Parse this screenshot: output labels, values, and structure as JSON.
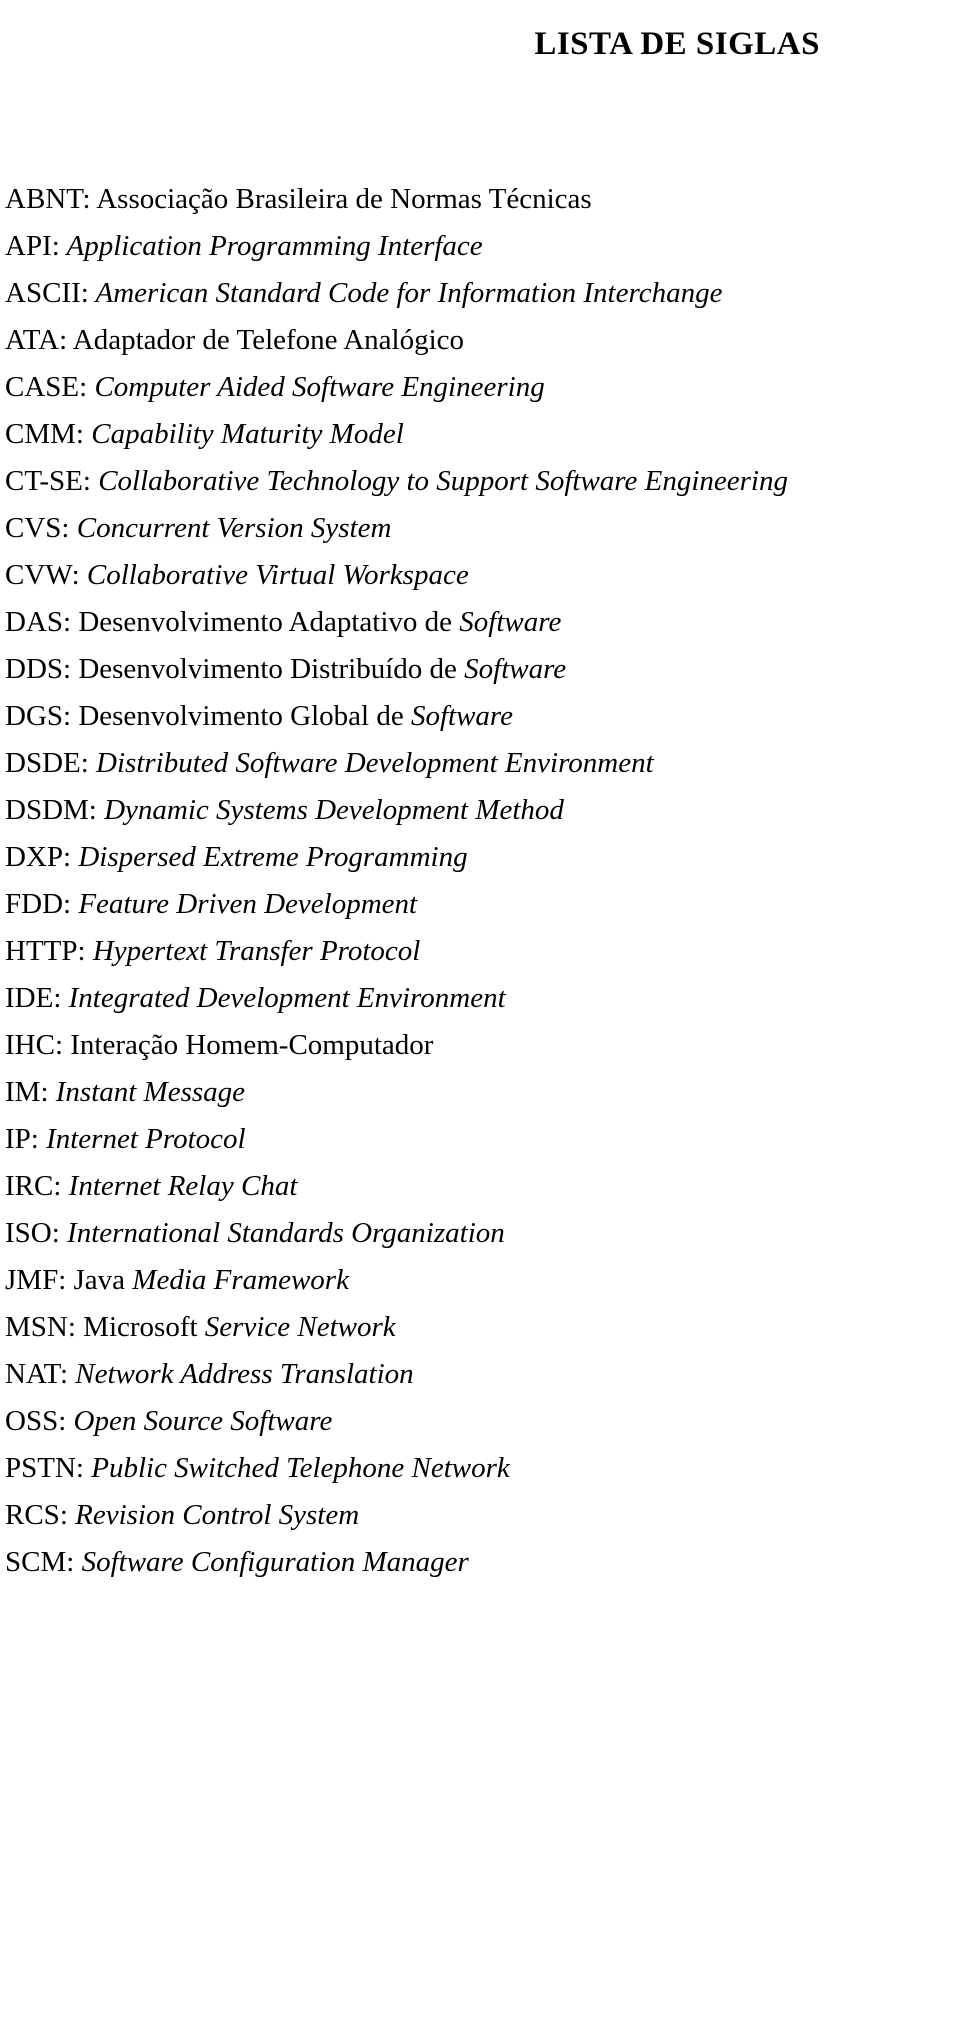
{
  "document": {
    "title": "LISTA DE SIGLAS"
  },
  "abbreviations": [
    {
      "key": "ABNT:",
      "segments": [
        {
          "text": " Associação Brasileira de Normas Técnicas",
          "style": "roman"
        }
      ]
    },
    {
      "key": "API:",
      "segments": [
        {
          "text": " Application Programming Interface",
          "style": "italic"
        }
      ]
    },
    {
      "key": "ASCII:",
      "segments": [
        {
          "text": " American Standard Code for Information Interchange",
          "style": "italic"
        }
      ]
    },
    {
      "key": "ATA:",
      "segments": [
        {
          "text": " Adaptador de Telefone Analógico",
          "style": "roman"
        }
      ]
    },
    {
      "key": "CASE:",
      "segments": [
        {
          "text": " Computer Aided Software Engineering",
          "style": "italic"
        }
      ]
    },
    {
      "key": "CMM:",
      "segments": [
        {
          "text": " Capability Maturity Model",
          "style": "italic"
        }
      ]
    },
    {
      "key": "CT-SE:",
      "segments": [
        {
          "text": " Collaborative Technology to Support Software Engineering",
          "style": "italic"
        }
      ]
    },
    {
      "key": "CVS:",
      "segments": [
        {
          "text": " Concurrent Version System",
          "style": "italic"
        }
      ]
    },
    {
      "key": "CVW:",
      "segments": [
        {
          "text": " Collaborative Virtual Workspace",
          "style": "italic"
        }
      ]
    },
    {
      "key": "DAS:",
      "segments": [
        {
          "text": " Desenvolvimento Adaptativo de ",
          "style": "roman"
        },
        {
          "text": "Software",
          "style": "italic"
        }
      ]
    },
    {
      "key": "DDS:",
      "segments": [
        {
          "text": " Desenvolvimento Distribuído de ",
          "style": "roman"
        },
        {
          "text": "Software",
          "style": "italic"
        }
      ]
    },
    {
      "key": "DGS:",
      "segments": [
        {
          "text": " Desenvolvimento Global de ",
          "style": "roman"
        },
        {
          "text": "Software",
          "style": "italic"
        }
      ]
    },
    {
      "key": "DSDE:",
      "segments": [
        {
          "text": " Distributed Software Development Environment",
          "style": "italic"
        }
      ]
    },
    {
      "key": "DSDM:",
      "segments": [
        {
          "text": " Dynamic Systems Development Method",
          "style": "italic"
        }
      ]
    },
    {
      "key": "DXP:",
      "segments": [
        {
          "text": " Dispersed Extreme Programming",
          "style": "italic"
        }
      ]
    },
    {
      "key": "FDD:",
      "segments": [
        {
          "text": " Feature Driven Development",
          "style": "italic"
        }
      ]
    },
    {
      "key": "HTTP:",
      "segments": [
        {
          "text": " Hypertext Transfer Protocol",
          "style": "italic"
        }
      ]
    },
    {
      "key": "IDE:",
      "segments": [
        {
          "text": " Integrated Development Environment",
          "style": "italic"
        }
      ]
    },
    {
      "key": "IHC:",
      "segments": [
        {
          "text": " Interação Homem-Computador",
          "style": "roman"
        }
      ]
    },
    {
      "key": "IM:",
      "segments": [
        {
          "text": " Instant Message",
          "style": "italic"
        }
      ]
    },
    {
      "key": "IP:",
      "segments": [
        {
          "text": " Internet Protocol",
          "style": "italic"
        }
      ]
    },
    {
      "key": "IRC:",
      "segments": [
        {
          "text": " Internet Relay Chat",
          "style": "italic"
        }
      ]
    },
    {
      "key": "ISO:",
      "segments": [
        {
          "text": " International Standards Organization",
          "style": "italic"
        }
      ]
    },
    {
      "key": "JMF:",
      "segments": [
        {
          "text": " Java ",
          "style": "roman"
        },
        {
          "text": "Media Framework",
          "style": "italic"
        }
      ]
    },
    {
      "key": "MSN:",
      "segments": [
        {
          "text": " Microsoft ",
          "style": "roman"
        },
        {
          "text": "Service Network",
          "style": "italic"
        }
      ]
    },
    {
      "key": "NAT:",
      "segments": [
        {
          "text": " Network Address Translation",
          "style": "italic"
        }
      ]
    },
    {
      "key": "OSS:",
      "segments": [
        {
          "text": " Open Source Software",
          "style": "italic"
        }
      ]
    },
    {
      "key": "PSTN:",
      "segments": [
        {
          "text": " Public Switched Telephone Network",
          "style": "italic"
        }
      ]
    },
    {
      "key": "RCS:",
      "segments": [
        {
          "text": " Revision Control System",
          "style": "italic"
        }
      ]
    },
    {
      "key": "SCM:",
      "segments": [
        {
          "text": " Software Configuration Manager",
          "style": "italic"
        }
      ]
    }
  ]
}
